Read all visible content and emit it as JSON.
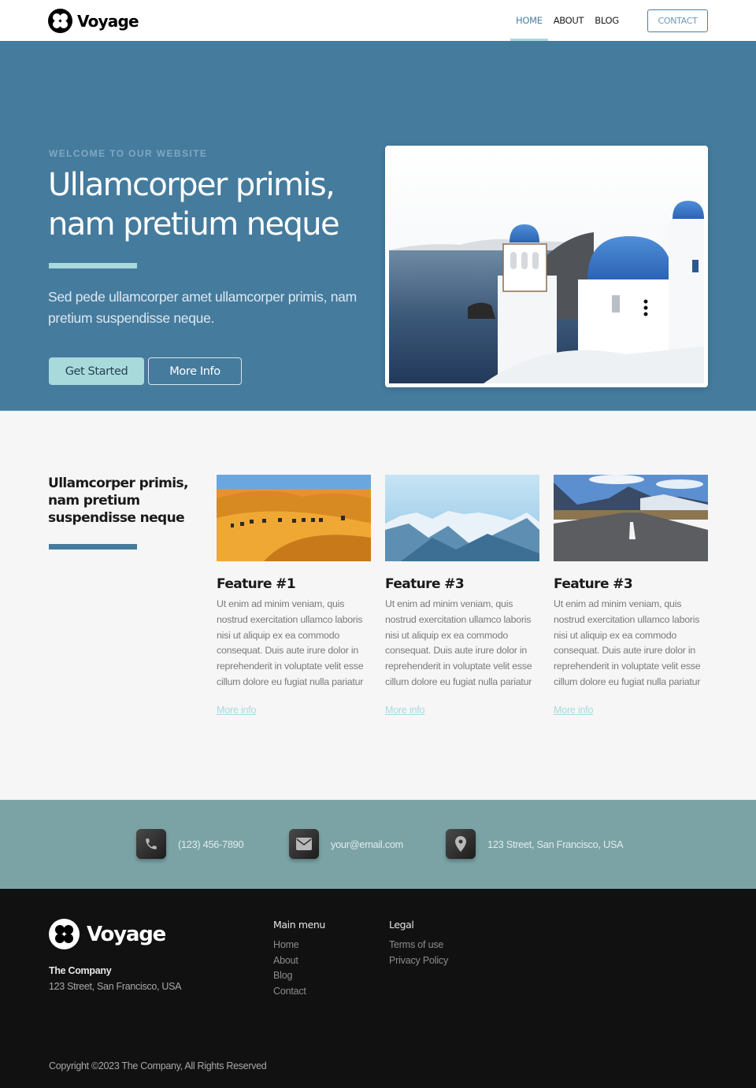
{
  "brand": {
    "name": "Voyage",
    "logo_icon": "four-petal-circle-logo"
  },
  "nav": {
    "links": [
      {
        "label": "HOME",
        "active": true
      },
      {
        "label": "ABOUT",
        "active": false
      },
      {
        "label": "BLOG",
        "active": false
      }
    ],
    "contact_label": "CONTACT"
  },
  "hero": {
    "eyebrow": "WELCOME TO OUR WEBSITE",
    "title": "Ullamcorper primis, nam pretium neque",
    "lead": "Sed pede ullamcorper amet ullamcorper primis, nam pretium suspendisse neque.",
    "primary_button": "Get Started",
    "secondary_button": "More Info",
    "image_alt": "Santorini white church with blue domes overlooking the sea"
  },
  "features": {
    "title": "Ullamcorper primis, nam pretium suspendisse neque",
    "items": [
      {
        "title": "Feature #1",
        "image": "desert-camel-caravan",
        "text": "Ut enim ad minim veniam, quis nostrud exercitation ullamco laboris nisi ut aliquip ex ea commodo consequat. Duis aute irure dolor in reprehenderit in voluptate velit esse cillum dolore eu fugiat nulla pariatur",
        "link": "More info"
      },
      {
        "title": "Feature #3",
        "image": "snowy-mountains",
        "text": "Ut enim ad minim veniam, quis nostrud exercitation ullamco laboris nisi ut aliquip ex ea commodo consequat. Duis aute irure dolor in reprehenderit in voluptate velit esse cillum dolore eu fugiat nulla pariatur",
        "link": "More info"
      },
      {
        "title": "Feature #3",
        "image": "mountain-road",
        "text": "Ut enim ad minim veniam, quis nostrud exercitation ullamco laboris nisi ut aliquip ex ea commodo consequat. Duis aute irure dolor in reprehenderit in voluptate velit esse cillum dolore eu fugiat nulla pariatur",
        "link": "More info"
      }
    ]
  },
  "contact": {
    "items": [
      {
        "icon": "phone-icon",
        "text": "(123) 456-7890"
      },
      {
        "icon": "envelope-icon",
        "text": "your@email.com"
      },
      {
        "icon": "map-pin-icon",
        "text": "123 Street, San Francisco, USA"
      }
    ]
  },
  "footer": {
    "brand_name": "Voyage",
    "company_name": "The Company",
    "company_address": "123 Street, San Francisco, USA",
    "main_menu": {
      "heading": "Main menu",
      "links": [
        "Home",
        "About",
        "Blog",
        "Contact"
      ]
    },
    "legal": {
      "heading": "Legal",
      "links": [
        "Terms of use",
        "Privacy Policy"
      ]
    },
    "copyright": "Copyright ©2023 The Company, All Rights Reserved"
  },
  "colors": {
    "primary": "#457b9d",
    "accent": "#a8dadc",
    "contact_strip": "#7ba3a5",
    "footer_bg": "#111111",
    "features_bg": "#f6f6f7"
  }
}
